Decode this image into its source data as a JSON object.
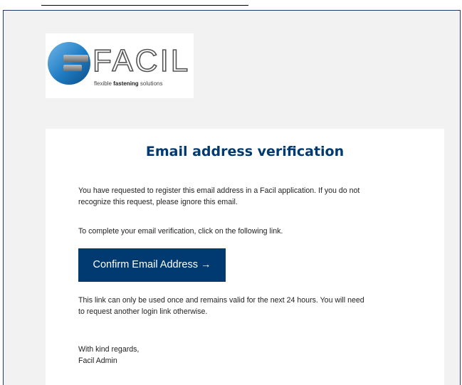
{
  "logo": {
    "wordmark": "FACIL",
    "tagline_prefix": "flexible ",
    "tagline_bold": "fastening",
    "tagline_suffix": " solutions"
  },
  "email": {
    "title": "Email address verification",
    "paragraph1_line1": "You have requested to register this email address in a Facil application. If you do not",
    "paragraph1_line2": "recognize this request, please ignore this email.",
    "paragraph2": "To complete your email verification, click on the following link.",
    "button_label": "Confirm Email Address",
    "button_arrow": "→",
    "paragraph3_line1": "This link can only be used once and remains valid for the next 24 hours. You will need",
    "paragraph3_line2": "to request another login link otherwise.",
    "signoff": "With kind regards,",
    "signature": "Facil Admin"
  },
  "colors": {
    "accent": "#003a70",
    "background": "#f2f2f2",
    "card": "#ffffff",
    "frame_border": "#1f3864"
  },
  "icons": {
    "logo_mark": "facil-logo-icon"
  }
}
